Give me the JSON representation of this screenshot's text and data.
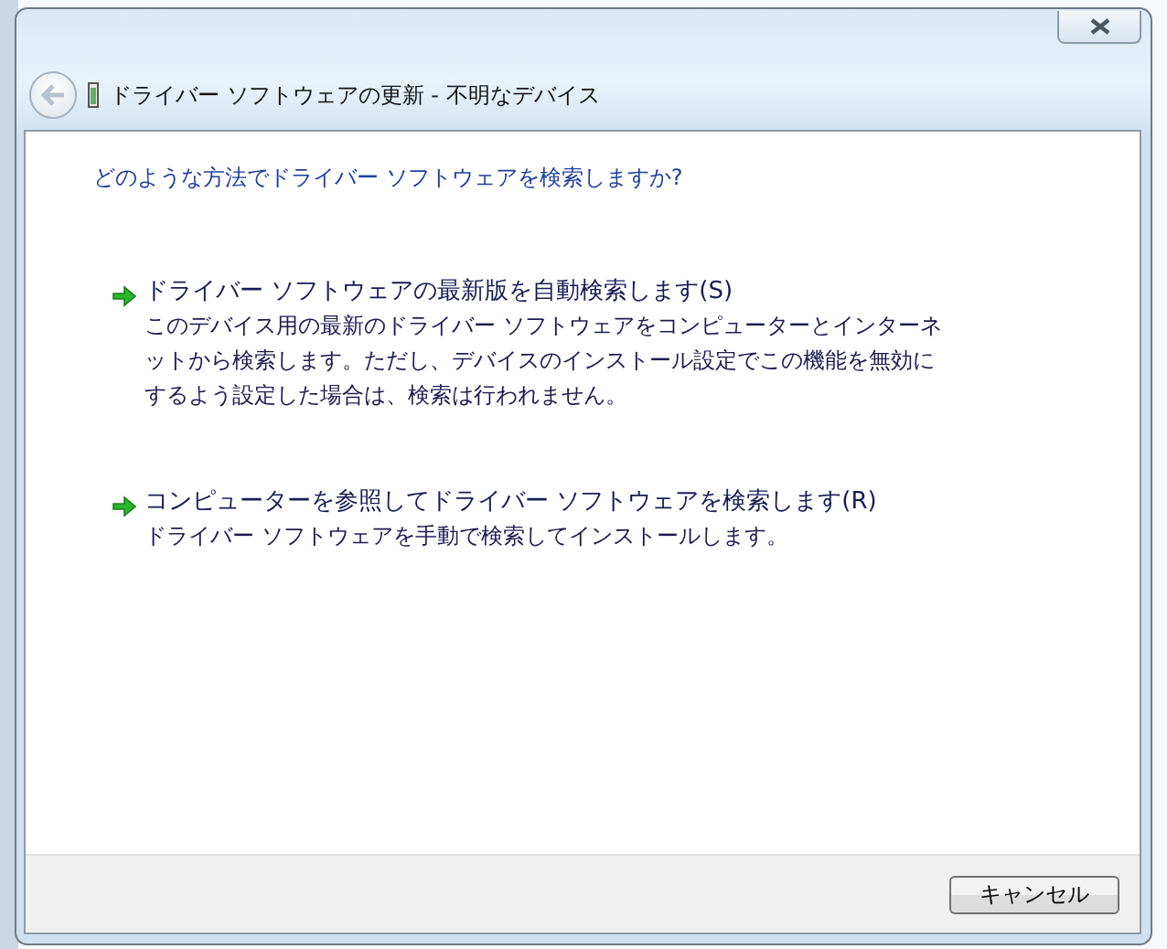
{
  "window": {
    "title": "ドライバー ソフトウェアの更新 - 不明なデバイス"
  },
  "question": "どのような方法でドライバー ソフトウェアを検索しますか?",
  "options": [
    {
      "title": "ドライバー ソフトウェアの最新版を自動検索します(S)",
      "description": "このデバイス用の最新のドライバー ソフトウェアをコンピューターとインターネットから検索します。ただし、デバイスのインストール設定でこの機能を無効にするよう設定した場合は、検索は行われません。"
    },
    {
      "title": "コンピューターを参照してドライバー ソフトウェアを検索します(R)",
      "description": "ドライバー ソフトウェアを手動で検索してインストールします。"
    }
  ],
  "buttons": [
    {
      "label": "キャンセル"
    }
  ]
}
